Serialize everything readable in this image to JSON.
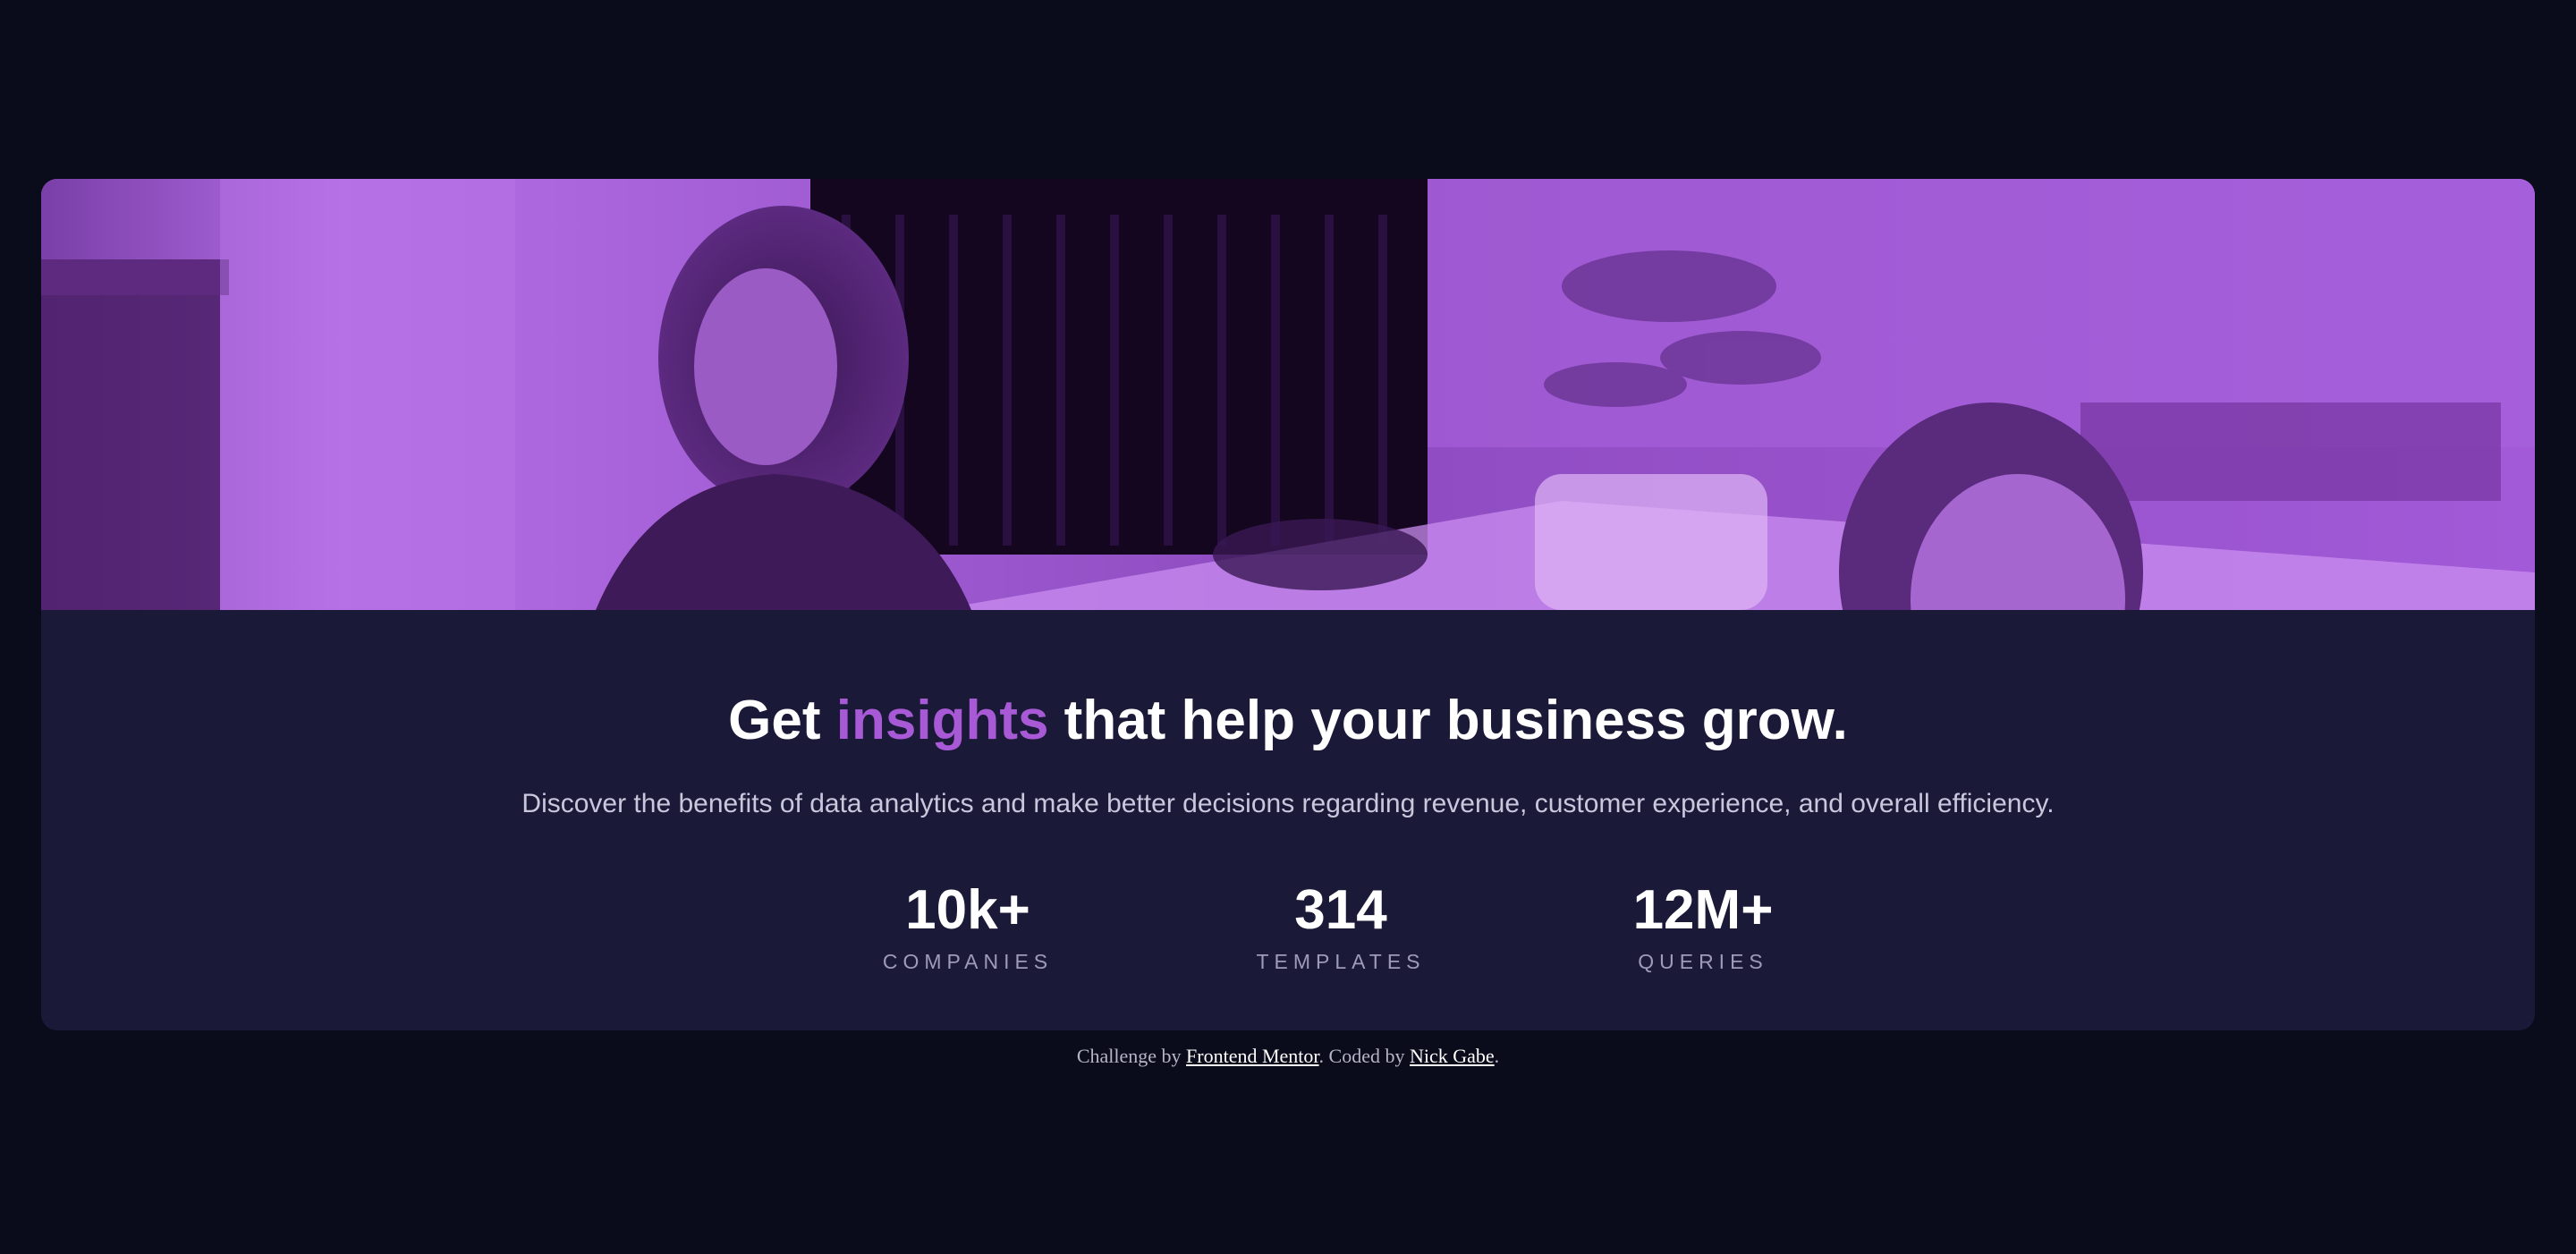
{
  "colors": {
    "page_background": "#0a0c1c",
    "card_background": "#1b1938",
    "accent": "#a85ad6",
    "heading": "#ffffff",
    "body_text": "#c9c7dc",
    "stat_label": "#9e9bb8"
  },
  "hero": {
    "image_icon": "photo-two-women-office-purple-tint"
  },
  "headline": {
    "before": "Get ",
    "accent": "insights",
    "after": " that help your business grow."
  },
  "subtitle": "Discover the benefits of data analytics and make better decisions regarding revenue, customer experience, and overall efficiency.",
  "stats": [
    {
      "value": "10k+",
      "label": "Companies"
    },
    {
      "value": "314",
      "label": "Templates"
    },
    {
      "value": "12M+",
      "label": "Queries"
    }
  ],
  "attribution": {
    "prefix": "Challenge by ",
    "link1": "Frontend Mentor",
    "middle": ". Coded by ",
    "link2": "Nick Gabe",
    "suffix": "."
  }
}
